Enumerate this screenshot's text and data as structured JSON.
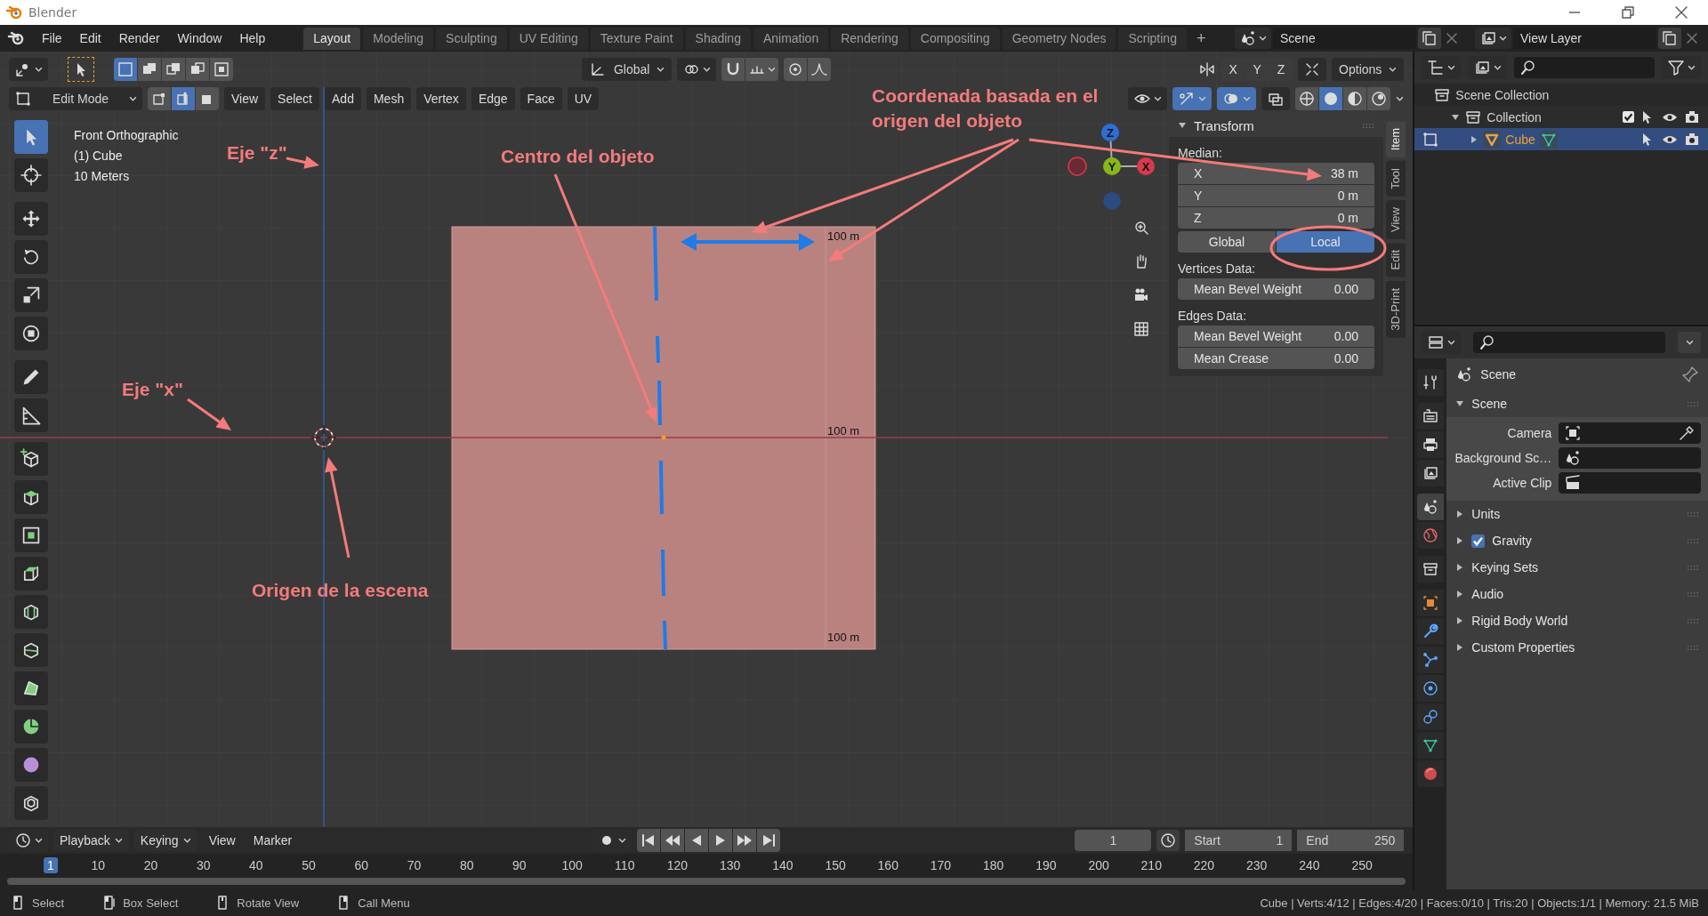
{
  "window": {
    "title": "Blender"
  },
  "menu": [
    "File",
    "Edit",
    "Render",
    "Window",
    "Help"
  ],
  "workspaces": [
    {
      "label": "Layout",
      "selected": true
    },
    {
      "label": "Modeling",
      "selected": false
    },
    {
      "label": "Sculpting",
      "selected": false
    },
    {
      "label": "UV Editing",
      "selected": false
    },
    {
      "label": "Texture Paint",
      "selected": false
    },
    {
      "label": "Shading",
      "selected": false
    },
    {
      "label": "Animation",
      "selected": false
    },
    {
      "label": "Rendering",
      "selected": false
    },
    {
      "label": "Compositing",
      "selected": false
    },
    {
      "label": "Geometry Nodes",
      "selected": false
    },
    {
      "label": "Scripting",
      "selected": false
    }
  ],
  "add_workspace": "+",
  "scene": "Scene",
  "view_layer": "View Layer",
  "viewport": {
    "box_modes": [
      {
        "kind": "set",
        "selected": true
      },
      {
        "kind": "extend",
        "selected": false
      },
      {
        "kind": "subtract",
        "selected": false
      },
      {
        "kind": "invert",
        "selected": false
      },
      {
        "kind": "intersect",
        "selected": false
      }
    ],
    "orientation": "Global",
    "mirror": [
      {
        "label": "X",
        "on": false
      },
      {
        "label": "Y",
        "on": false
      },
      {
        "label": "Z",
        "on": false
      }
    ],
    "options": "Options",
    "mode": "Edit Mode",
    "select_modes": [
      {
        "kind": "vertex",
        "selected": false
      },
      {
        "kind": "edge",
        "selected": true
      },
      {
        "kind": "face",
        "selected": false
      }
    ],
    "menus": [
      "View",
      "Select",
      "Add",
      "Mesh",
      "Vertex",
      "Edge",
      "Face",
      "UV"
    ],
    "view_toggles": [
      {
        "kind": "visibility",
        "on": false
      },
      {
        "kind": "gizmos",
        "on": true
      },
      {
        "kind": "overlays",
        "on": true
      },
      {
        "kind": "xray",
        "on": false
      }
    ],
    "shading": [
      {
        "kind": "wireframe",
        "selected": false
      },
      {
        "kind": "solid",
        "selected": true
      },
      {
        "kind": "material",
        "selected": false
      },
      {
        "kind": "rendered",
        "selected": false
      }
    ],
    "info": [
      "Front Orthographic",
      "(1) Cube",
      "10 Meters"
    ],
    "tools": [
      {
        "kind": "select",
        "selected": true
      },
      {
        "kind": "cursor",
        "selected": false
      },
      {
        "kind": "move",
        "selected": false
      },
      {
        "kind": "rotate",
        "selected": false
      },
      {
        "kind": "scale",
        "selected": false
      },
      {
        "kind": "transform",
        "selected": false
      },
      {
        "kind": "annotate",
        "selected": false
      },
      {
        "kind": "measure",
        "selected": false
      },
      {
        "kind": "add_cube",
        "selected": false
      },
      {
        "kind": "extrude",
        "selected": false
      },
      {
        "kind": "inset",
        "selected": false
      },
      {
        "kind": "bevel",
        "selected": false
      },
      {
        "kind": "loop_cut",
        "selected": false
      },
      {
        "kind": "knife",
        "selected": false
      },
      {
        "kind": "poly_build",
        "selected": false
      },
      {
        "kind": "spin",
        "selected": false
      },
      {
        "kind": "smooth",
        "selected": false
      },
      {
        "kind": "shrink",
        "selected": false
      }
    ],
    "grid_labels": [
      "100 m",
      "100 m",
      "100 m"
    ],
    "gizmo_axes": [
      {
        "label": "Z",
        "color": "#2e6ed4"
      },
      {
        "label": "Y",
        "color": "#86b81a"
      },
      {
        "label": "X",
        "color": "#d8394c"
      }
    ],
    "annotations": [
      {
        "text": "Coordenada basada en el\norigen del objeto"
      },
      {
        "text": "Eje \"z\""
      },
      {
        "text": "Centro del objeto"
      },
      {
        "text": "Eje \"x\""
      },
      {
        "text": "Origen de la escena"
      }
    ]
  },
  "sidebar": {
    "tabs": [
      {
        "label": "Item",
        "selected": true
      },
      {
        "label": "Tool",
        "selected": false
      },
      {
        "label": "View",
        "selected": false
      },
      {
        "label": "Edit",
        "selected": false
      },
      {
        "label": "3D-Print",
        "selected": false
      }
    ],
    "panel": {
      "title": "Transform",
      "expanded": true
    },
    "median_label": "Median:",
    "median": [
      {
        "axis": "X",
        "value": "38 m"
      },
      {
        "axis": "Y",
        "value": "0 m"
      },
      {
        "axis": "Z",
        "value": "0 m"
      }
    ],
    "space": [
      {
        "label": "Global",
        "selected": false
      },
      {
        "label": "Local",
        "selected": true
      }
    ],
    "vertices_label": "Vertices Data:",
    "vertices": [
      {
        "label": "Mean Bevel Weight",
        "value": "0.00"
      }
    ],
    "edges_label": "Edges Data:",
    "edges": [
      {
        "label": "Mean Bevel Weight",
        "value": "0.00"
      },
      {
        "label": "Mean Crease",
        "value": "0.00"
      }
    ]
  },
  "outliner": {
    "tree": [
      {
        "kind": "scene_collection",
        "name": "Scene Collection",
        "selected": false,
        "children": [
          {
            "kind": "collection",
            "name": "Collection",
            "selected": false,
            "expanded": true,
            "checked": true,
            "children": [
              {
                "kind": "object",
                "name": "Cube",
                "selected": true,
                "expanded": false
              }
            ]
          }
        ]
      }
    ]
  },
  "properties": {
    "tabs": [
      {
        "kind": "tool",
        "selected": false
      },
      {
        "kind": "render",
        "selected": false
      },
      {
        "kind": "output",
        "selected": false
      },
      {
        "kind": "view_layer",
        "selected": false
      },
      {
        "kind": "scene",
        "selected": true
      },
      {
        "kind": "world",
        "selected": false
      },
      {
        "kind": "collection",
        "selected": false
      },
      {
        "kind": "object",
        "selected": false
      },
      {
        "kind": "modifiers",
        "selected": false
      },
      {
        "kind": "particles",
        "selected": false
      },
      {
        "kind": "physics",
        "selected": false
      },
      {
        "kind": "constraints",
        "selected": false
      },
      {
        "kind": "data",
        "selected": false
      },
      {
        "kind": "material",
        "selected": false
      }
    ],
    "context": "Scene",
    "panel": {
      "title": "Scene",
      "expanded": true,
      "fields": [
        {
          "kind": "camera",
          "label": "Camera"
        },
        {
          "kind": "scene",
          "label": "Background Sc…"
        },
        {
          "kind": "clip",
          "label": "Active Clip"
        }
      ]
    },
    "subpanels": [
      {
        "title": "Units",
        "expanded": false
      },
      {
        "title": "Gravity",
        "expanded": false,
        "checked": true
      },
      {
        "title": "Keying Sets",
        "expanded": false
      },
      {
        "title": "Audio",
        "expanded": false
      },
      {
        "title": "Rigid Body World",
        "expanded": false
      },
      {
        "title": "Custom Properties",
        "expanded": false
      }
    ]
  },
  "timeline": {
    "menus": [
      {
        "label": "Playback",
        "dropdown": true
      },
      {
        "label": "Keying",
        "dropdown": true
      },
      {
        "label": "View",
        "dropdown": false
      },
      {
        "label": "Marker",
        "dropdown": false
      }
    ],
    "current_frame": "1",
    "start_label": "Start",
    "start": "1",
    "end_label": "End",
    "end": "250",
    "ruler": [
      {
        "label": "1",
        "selected": true
      },
      {
        "label": "10",
        "selected": false
      },
      {
        "label": "20",
        "selected": false
      },
      {
        "label": "30",
        "selected": false
      },
      {
        "label": "40",
        "selected": false
      },
      {
        "label": "50",
        "selected": false
      },
      {
        "label": "60",
        "selected": false
      },
      {
        "label": "70",
        "selected": false
      },
      {
        "label": "80",
        "selected": false
      },
      {
        "label": "90",
        "selected": false
      },
      {
        "label": "100",
        "selected": false
      },
      {
        "label": "110",
        "selected": false
      },
      {
        "label": "120",
        "selected": false
      },
      {
        "label": "130",
        "selected": false
      },
      {
        "label": "140",
        "selected": false
      },
      {
        "label": "150",
        "selected": false
      },
      {
        "label": "160",
        "selected": false
      },
      {
        "label": "170",
        "selected": false
      },
      {
        "label": "180",
        "selected": false
      },
      {
        "label": "190",
        "selected": false
      },
      {
        "label": "200",
        "selected": false
      },
      {
        "label": "210",
        "selected": false
      },
      {
        "label": "220",
        "selected": false
      },
      {
        "label": "230",
        "selected": false
      },
      {
        "label": "240",
        "selected": false
      },
      {
        "label": "250",
        "selected": false
      }
    ]
  },
  "status_bar": {
    "hints": [
      {
        "kind": "left",
        "label": "Select"
      },
      {
        "kind": "drag",
        "label": "Box Select"
      },
      {
        "kind": "middle",
        "label": "Rotate View"
      },
      {
        "kind": "right",
        "label": "Call Menu"
      }
    ],
    "stats": "Cube | Verts:4/12 | Edges:4/20 | Faces:0/10 | Tris:20 | Objects:1/1 | Memory: 21.5 MiB"
  }
}
